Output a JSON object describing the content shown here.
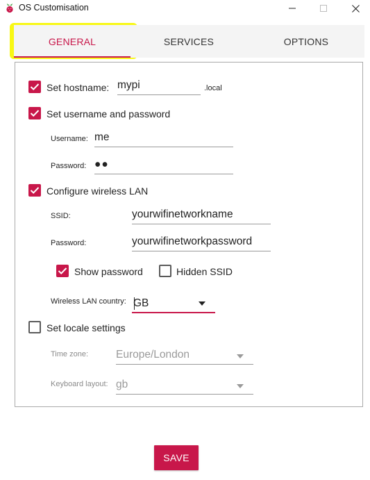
{
  "window": {
    "title": "OS Customisation",
    "app_icon": "raspberry-icon",
    "controls": [
      "minimize-icon",
      "maximize-icon",
      "close-icon"
    ]
  },
  "tabs": [
    {
      "label": "GENERAL",
      "selected": true
    },
    {
      "label": "SERVICES",
      "selected": false
    },
    {
      "label": "OPTIONS",
      "selected": false
    }
  ],
  "colors": {
    "accent": "#c8174a",
    "highlight": "#f7f700"
  },
  "general": {
    "hostname": {
      "label": "Set hostname:",
      "checked": true,
      "value": "mypi",
      "suffix": ".local"
    },
    "user": {
      "label": "Set username and password",
      "checked": true,
      "username_label": "Username:",
      "username_value": "me",
      "password_label": "Password:",
      "password_value": "●●"
    },
    "wifi": {
      "label": "Configure wireless LAN",
      "checked": true,
      "ssid_label": "SSID:",
      "ssid_value": "yourwifinetworkname",
      "password_label": "Password:",
      "password_value": "yourwifinetworkpassword",
      "show_password_label": "Show password",
      "show_password_checked": true,
      "hidden_ssid_label": "Hidden SSID",
      "hidden_ssid_checked": false,
      "country_label": "Wireless LAN country:",
      "country_value": "GB"
    },
    "locale": {
      "label": "Set locale settings",
      "checked": false,
      "timezone_label": "Time zone:",
      "timezone_value": "Europe/London",
      "keyboard_label": "Keyboard layout:",
      "keyboard_value": "gb"
    }
  },
  "save_label": "SAVE"
}
